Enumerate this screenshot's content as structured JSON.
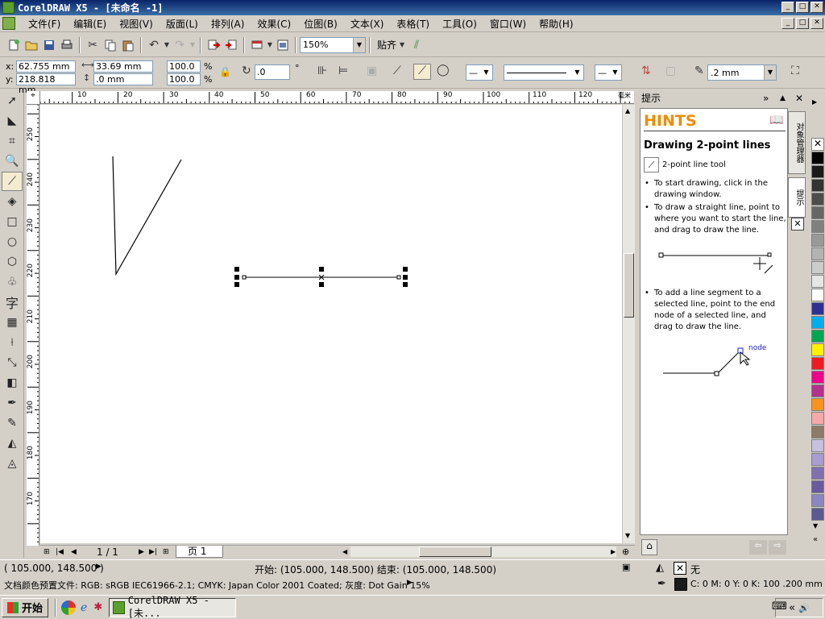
{
  "window": {
    "title": "CorelDRAW X5 - [未命名 -1]",
    "min": "_",
    "max": "□",
    "close": "✕"
  },
  "menu": [
    "文件(F)",
    "编辑(E)",
    "视图(V)",
    "版面(L)",
    "排列(A)",
    "效果(C)",
    "位图(B)",
    "文本(X)",
    "表格(T)",
    "工具(O)",
    "窗口(W)",
    "帮助(H)"
  ],
  "toolbar": {
    "zoom": "150%",
    "snap": "贴齐"
  },
  "props": {
    "x_label": "x:",
    "x": "62.755 mm",
    "y_label": "y:",
    "y": "218.818 mm",
    "w": "33.69 mm",
    "h": ".0 mm",
    "sx": "100.0",
    "sy": "100.0",
    "pct": "%",
    "angle": ".0",
    "deg": "°",
    "outline_width": ".2 mm"
  },
  "hruler_ticks": [
    "10",
    "20",
    "30",
    "40",
    "50",
    "60",
    "70",
    "80",
    "90",
    "100",
    "110",
    "120"
  ],
  "vruler_ticks": [
    "250",
    "240",
    "230",
    "220",
    "210",
    "200",
    "190",
    "180",
    "170"
  ],
  "ruler_units": "毫米",
  "page_nav": {
    "count": "1 / 1",
    "tab": "页 1"
  },
  "docker": {
    "header": "提示",
    "title": "HINTS",
    "subtitle": "Drawing 2-point lines",
    "tool_name": "2-point line tool",
    "hint1": "To start drawing, click in the drawing window.",
    "hint2": "To draw a straight line, point to where you want to start the line, and drag to draw the line.",
    "hint3": "To add a line segment to a selected line, point to the end node of a selected line, and drag to draw the line.",
    "node_label": "node",
    "tab_object_manager": "对象管理器",
    "tab_hints": "提示"
  },
  "palette": [
    "#ffffff",
    "#000000",
    "#1a1a1a",
    "#333333",
    "#4d4d4d",
    "#666666",
    "#808080",
    "#999999",
    "#b3b3b3",
    "#cccccc",
    "#e6e6e6",
    "#ffffff",
    "#2e3192",
    "#00aeef",
    "#00a651",
    "#fff200",
    "#ed1c24",
    "#ec008c",
    "#b2328c",
    "#f7941d",
    "#f5a9a9",
    "#8c7b6b",
    "#c8c0e0",
    "#a89cd0",
    "#8070b0",
    "#6a5aa0",
    "#8a86c0",
    "#5a5a90"
  ],
  "status": {
    "coords": "( 105.000, 148.500 )",
    "startend": "开始: (105.000, 148.500) 结束: (105.000, 148.500)",
    "fill_none": "无",
    "color_profile": "文档颜色预置文件: RGB: sRGB IEC61966-2.1; CMYK: Japan Color 2001 Coated; 灰度: Dot Gain 15%",
    "outline_info": "C: 0 M: 0 Y: 0 K: 100  .200 mm"
  },
  "taskbar": {
    "start": "开始",
    "task": "CorelDRAW X5 - [未...",
    "tray_arrow": "«"
  }
}
